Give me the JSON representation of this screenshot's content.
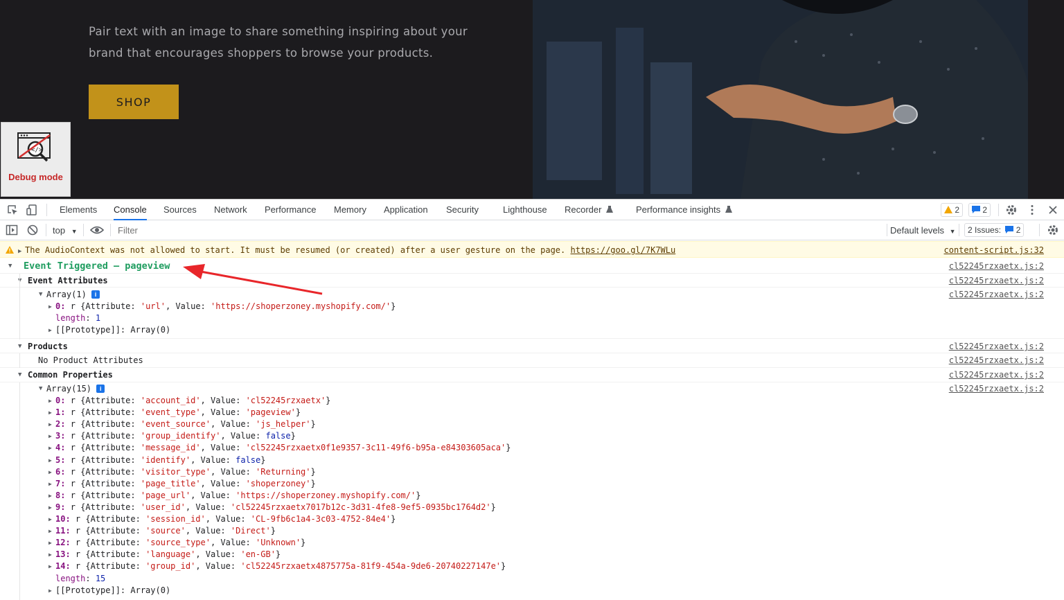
{
  "store": {
    "promo_text": "Pair text with an image to share something inspiring about your brand that encourages shoppers to browse your products.",
    "shop_button": "SHOP",
    "debug_label": "Debug mode"
  },
  "devtools": {
    "tabs": [
      "Elements",
      "Console",
      "Sources",
      "Network",
      "Performance",
      "Memory",
      "Application",
      "Security",
      "Lighthouse",
      "Recorder",
      "Performance insights"
    ],
    "active_tab": "Console",
    "warnings_count": "2",
    "messages_count": "2",
    "context": "top",
    "filter_placeholder": "Filter",
    "levels": "Default levels",
    "issues_label": "2 Issues:",
    "issues_count": "2"
  },
  "console": {
    "warning": {
      "text": "The AudioContext was not allowed to start. It must be resumed (or created) after a user gesture on the page.",
      "link": "https://goo.gl/7K7WLu",
      "source": "content-script.js:32"
    },
    "event_title": "Event Triggered – pageview",
    "event_source": "cl52245rzxaetx.js:2",
    "event_attributes": {
      "label": "Event Attributes",
      "source": "cl52245rzxaetx.js:2",
      "array_label": "Array(1)",
      "array_source": "cl52245rzxaetx.js:2",
      "items": [
        {
          "index": "0",
          "attribute": "'url'",
          "value": "'https://shoperzoney.myshopify.com/'"
        }
      ],
      "length": "1",
      "prototype": "Array(0)"
    },
    "products": {
      "label": "Products",
      "source": "cl52245rzxaetx.js:2",
      "message": "No Product Attributes",
      "message_source": "cl52245rzxaetx.js:2"
    },
    "common_properties": {
      "label": "Common Properties",
      "source": "cl52245rzxaetx.js:2",
      "array_label": "Array(15)",
      "array_source": "cl52245rzxaetx.js:2",
      "items": [
        {
          "index": "0",
          "attribute": "'account_id'",
          "value": "'cl52245rzxaetx'"
        },
        {
          "index": "1",
          "attribute": "'event_type'",
          "value": "'pageview'"
        },
        {
          "index": "2",
          "attribute": "'event_source'",
          "value": "'js_helper'"
        },
        {
          "index": "3",
          "attribute": "'group_identify'",
          "value": "false"
        },
        {
          "index": "4",
          "attribute": "'message_id'",
          "value": "'cl52245rzxaetx0f1e9357-3c11-49f6-b95a-e84303605aca'"
        },
        {
          "index": "5",
          "attribute": "'identify'",
          "value": "false"
        },
        {
          "index": "6",
          "attribute": "'visitor_type'",
          "value": "'Returning'"
        },
        {
          "index": "7",
          "attribute": "'page_title'",
          "value": "'shoperzoney'"
        },
        {
          "index": "8",
          "attribute": "'page_url'",
          "value": "'https://shoperzoney.myshopify.com/'"
        },
        {
          "index": "9",
          "attribute": "'user_id'",
          "value": "'cl52245rzxaetx7017b12c-3d31-4fe8-9ef5-0935bc1764d2'"
        },
        {
          "index": "10",
          "attribute": "'session_id'",
          "value": "'CL-9fb6c1a4-3c03-4752-84e4'"
        },
        {
          "index": "11",
          "attribute": "'source'",
          "value": "'Direct'"
        },
        {
          "index": "12",
          "attribute": "'source_type'",
          "value": "'Unknown'"
        },
        {
          "index": "13",
          "attribute": "'language'",
          "value": "'en-GB'"
        },
        {
          "index": "14",
          "attribute": "'group_id'",
          "value": "'cl52245rzxaetx4875775a-81f9-454a-9de6-20740227147e'"
        }
      ],
      "length": "15",
      "prototype": "Array(0)"
    }
  },
  "colors": {
    "accent": "#1a73e8",
    "event_title": "#1d9c5e",
    "shop_button": "#c2921a",
    "annotation_arrow": "#e8262a"
  }
}
